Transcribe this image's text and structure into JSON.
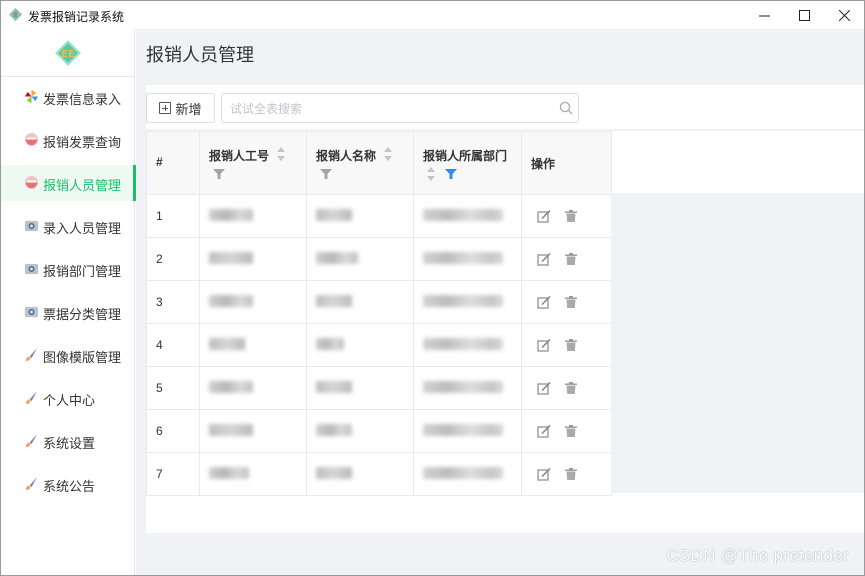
{
  "window": {
    "title": "发票报销记录系统",
    "controls": {
      "minimize": "—",
      "maximize": "☐",
      "close": "✕"
    }
  },
  "sidebar": {
    "logo_icon": "ee-diamond-logo",
    "items": [
      {
        "label": "发票信息录入",
        "icon": "pinwheel-icon",
        "active": false
      },
      {
        "label": "报销发票查询",
        "icon": "bowl-icon",
        "active": false
      },
      {
        "label": "报销人员管理",
        "icon": "bowl-icon",
        "active": true
      },
      {
        "label": "录入人员管理",
        "icon": "camera-icon",
        "active": false
      },
      {
        "label": "报销部门管理",
        "icon": "camera-icon",
        "active": false
      },
      {
        "label": "票据分类管理",
        "icon": "camera-icon",
        "active": false
      },
      {
        "label": "图像模版管理",
        "icon": "brush-icon",
        "active": false
      },
      {
        "label": "个人中心",
        "icon": "brush-icon",
        "active": false
      },
      {
        "label": "系统设置",
        "icon": "brush-icon",
        "active": false
      },
      {
        "label": "系统公告",
        "icon": "brush-icon",
        "active": false
      }
    ],
    "accent_color": "#18c06a"
  },
  "main": {
    "page_title": "报销人员管理",
    "toolbar": {
      "add_label": "新增",
      "search_placeholder": "试试全表搜索"
    },
    "table": {
      "columns": [
        "#",
        "报销人工号",
        "报销人名称",
        "报销人所属部门",
        "操作"
      ],
      "active_filter_color": "#2d8cf0",
      "rows": [
        {
          "index": "1"
        },
        {
          "index": "2"
        },
        {
          "index": "3"
        },
        {
          "index": "4"
        },
        {
          "index": "5"
        },
        {
          "index": "6"
        },
        {
          "index": "7"
        }
      ],
      "row_actions": [
        "edit-icon",
        "trash-icon"
      ]
    }
  },
  "watermark": "CSDN @The  pretender"
}
